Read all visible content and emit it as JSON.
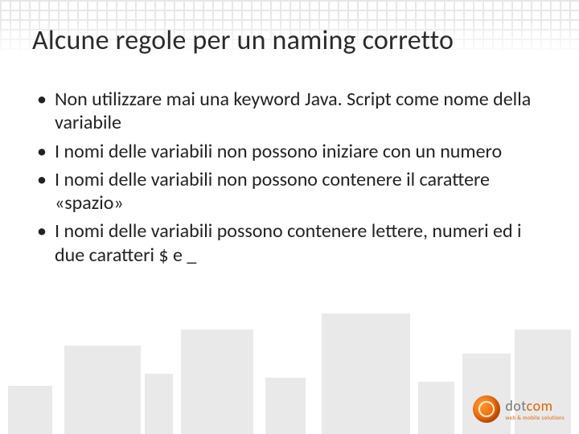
{
  "title": "Alcune regole per un naming corretto",
  "bullets": [
    "Non utilizzare mai una keyword Java. Script come nome della variabile",
    "I nomi delle variabili non possono iniziare con un numero",
    "I nomi delle variabili non possono contenere il carattere «spazio»",
    "I nomi delle variabili possono contenere lettere, numeri ed i due caratteri $ e _"
  ],
  "logo": {
    "main_prefix": "dot",
    "main_accent": "com",
    "sub": "web & mobile solutions"
  }
}
